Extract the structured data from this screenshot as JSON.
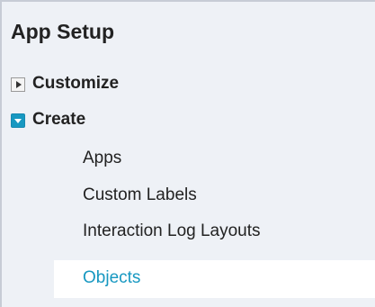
{
  "setup_tree": {
    "title": "App Setup",
    "groups": [
      {
        "label": "Customize",
        "expanded": false,
        "icon": "collapsed-toggle-icon"
      },
      {
        "label": "Create",
        "expanded": true,
        "icon": "expanded-toggle-icon",
        "items": [
          {
            "label": "Apps",
            "selected": false
          },
          {
            "label": "Custom Labels",
            "selected": false
          },
          {
            "label": "Interaction Log Layouts",
            "selected": false
          },
          {
            "label": "Objects",
            "selected": true
          }
        ]
      }
    ]
  },
  "colors": {
    "panel_background": "#eef1f6",
    "accent": "#1798c1",
    "selected_row_background": "#ffffff",
    "text": "#222222"
  }
}
